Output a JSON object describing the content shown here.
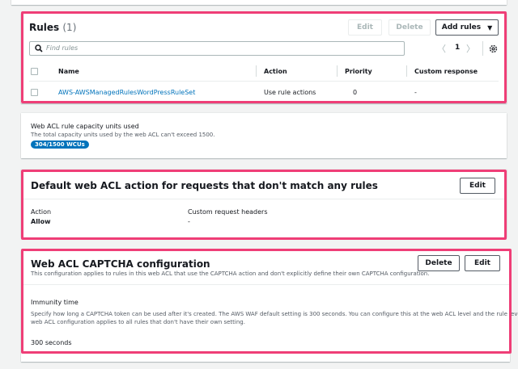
{
  "rules": {
    "title": "Rules",
    "count": "(1)",
    "edit_label": "Edit",
    "delete_label": "Delete",
    "add_rules_label": "Add rules",
    "search_placeholder": "Find rules",
    "page_number": "1",
    "columns": [
      "Name",
      "Action",
      "Priority",
      "Custom response"
    ],
    "rows": [
      {
        "name": "AWS-AWSManagedRulesWordPressRuleSet",
        "action": "Use rule actions",
        "priority": "0",
        "custom_response": "-"
      }
    ]
  },
  "capacity": {
    "title": "Web ACL rule capacity units used",
    "description": "The total capacity units used by the web ACL can't exceed 1500.",
    "badge": "304/1500 WCUs"
  },
  "default_action": {
    "title": "Default web ACL action for requests that don't match any rules",
    "edit_label": "Edit",
    "action_label": "Action",
    "action_value": "Allow",
    "headers_label": "Custom request headers",
    "headers_value": "-"
  },
  "captcha": {
    "title": "Web ACL CAPTCHA configuration",
    "description": "This configuration applies to rules in this web ACL that use the CAPTCHA action and don't explicitly define their own CAPTCHA configuration.",
    "delete_label": "Delete",
    "edit_label": "Edit",
    "immunity_title": "Immunity time",
    "immunity_desc_1": "Specify how long a CAPTCHA token can be used after it's created. The AWS WAF default setting is 300 seconds. You can configure this at the web ACL level and the rule level. The",
    "immunity_desc_2": "web ACL configuration applies to all rules that don't have their own setting.",
    "immunity_value": "300 seconds"
  },
  "colors": {
    "highlight": "#ef3e77",
    "link": "#0073bb",
    "badge": "#0073bb"
  }
}
